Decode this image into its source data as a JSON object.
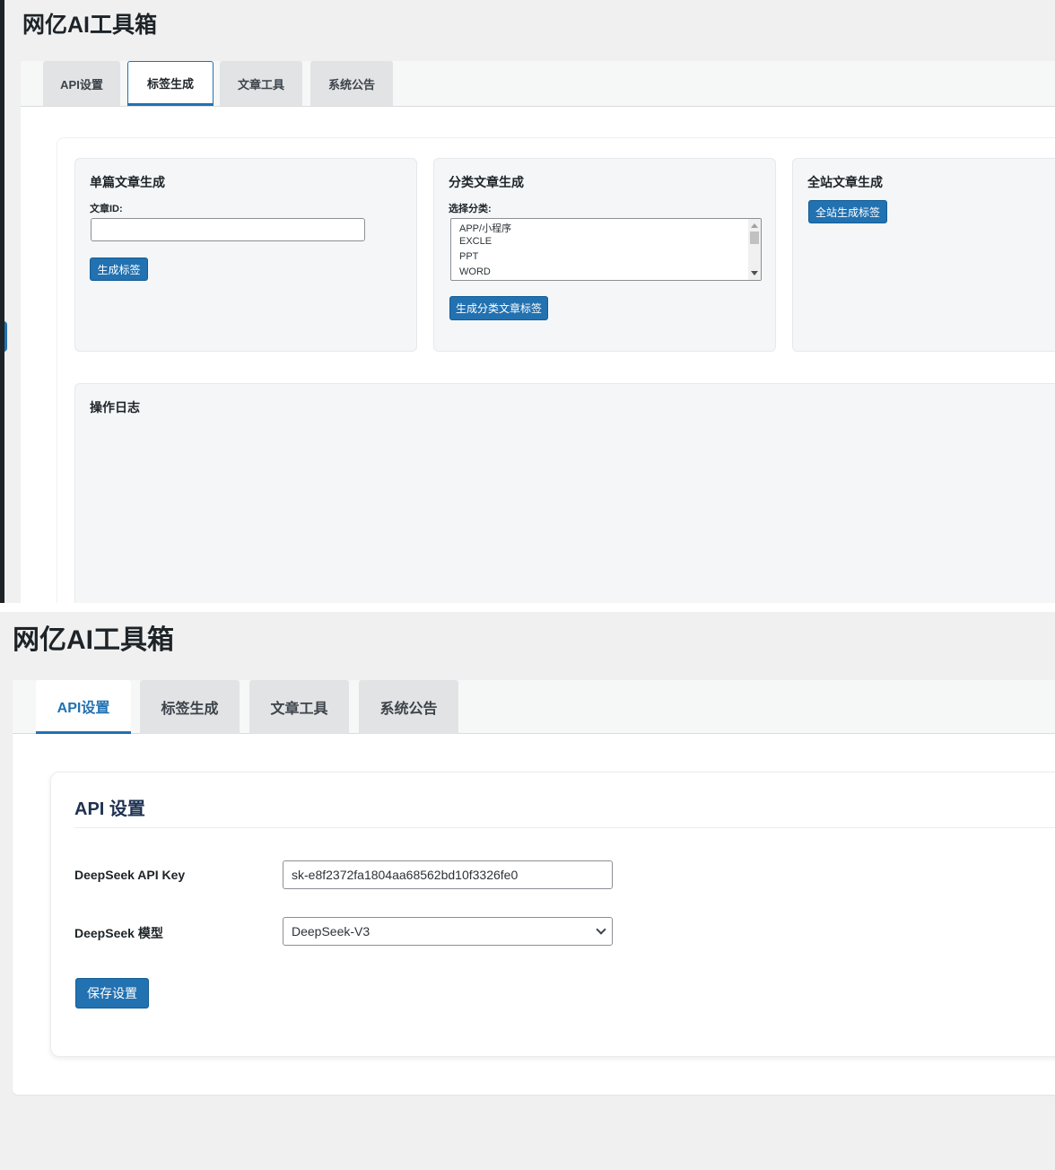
{
  "app": {
    "title": "网亿AI工具箱"
  },
  "tabs": {
    "api": "API设置",
    "tags": "标签生成",
    "article": "文章工具",
    "notice": "系统公告"
  },
  "tag_generation": {
    "single": {
      "title": "单篇文章生成",
      "id_label": "文章ID:",
      "id_value": "",
      "button": "生成标签"
    },
    "category": {
      "title": "分类文章生成",
      "select_label": "选择分类:",
      "options": [
        "APP/小程序",
        "EXCLE",
        "PPT",
        "WORD"
      ],
      "button": "生成分类文章标签"
    },
    "site": {
      "title": "全站文章生成",
      "button": "全站生成标签"
    },
    "log": {
      "title": "操作日志"
    }
  },
  "api_settings": {
    "title": "API 设置",
    "key_label": "DeepSeek API Key",
    "key_value": "sk-e8f2372fa1804aa68562bd10f3326fe0",
    "model_label": "DeepSeek 模型",
    "model_value": "DeepSeek-V3",
    "save_button": "保存设置"
  },
  "colors": {
    "accent": "#2271b1",
    "background": "#f0f0f1",
    "panel": "#f4f6f8"
  }
}
